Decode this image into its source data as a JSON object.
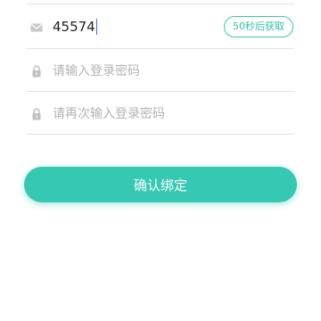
{
  "form": {
    "code_row": {
      "icon": "envelope-icon",
      "value": "45574",
      "get_code_label": "50秒后获取"
    },
    "password_row": {
      "icon": "lock-icon",
      "placeholder": "请输入登录密码",
      "value": ""
    },
    "confirm_password_row": {
      "icon": "lock-icon",
      "placeholder": "请再次输入登录密码",
      "value": ""
    },
    "submit_label": "确认绑定"
  },
  "colors": {
    "accent": "#35c8b3",
    "icon_gray": "#c2c2c2",
    "divider": "#e4e4e4",
    "placeholder": "#b3b3b3",
    "caret": "#3a6ee8"
  }
}
